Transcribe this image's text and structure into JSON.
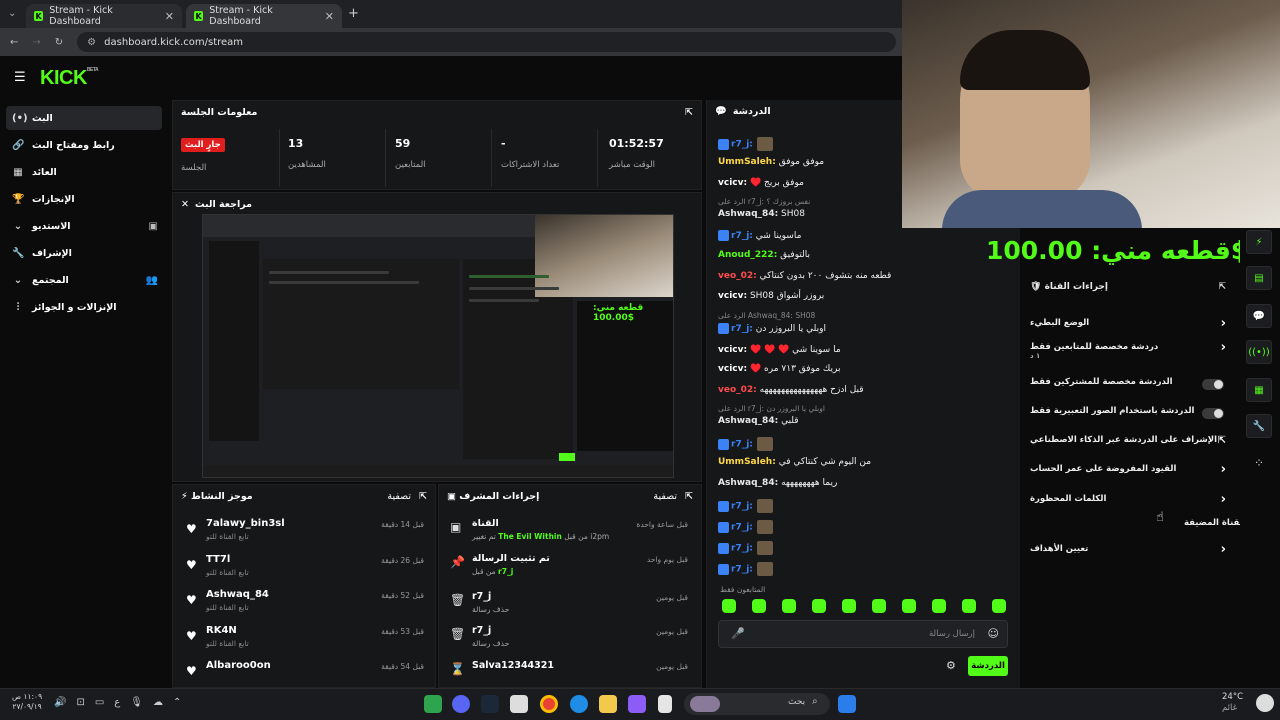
{
  "browser": {
    "tabs": [
      {
        "title": "Stream - Kick Dashboard"
      },
      {
        "title": "Stream - Kick Dashboard"
      }
    ],
    "url": "dashboard.kick.com/stream"
  },
  "kick": {
    "logo": "KICK",
    "logo_sup": "BETA"
  },
  "sidebar": {
    "items": [
      {
        "label": "البث",
        "icon": "broadcast-icon"
      },
      {
        "label": "رابط ومفتاح البث",
        "icon": "link-icon"
      },
      {
        "label": "العائد",
        "icon": "dollar-icon"
      },
      {
        "label": "الإنجازات",
        "icon": "trophy-icon"
      },
      {
        "label": "الاستديو",
        "icon": "chevron-down-icon"
      },
      {
        "label": "الإشراف",
        "icon": "wrench-icon"
      },
      {
        "label": "المجتمع",
        "icon": "chevron-down-icon"
      },
      {
        "label": "الإنزالات و الجوائز",
        "icon": "gift-icon"
      }
    ]
  },
  "session": {
    "title": "معلومات الجلسة",
    "live_badge": "جارٍ البث",
    "session_label": "الجلسة",
    "viewers": "13",
    "viewers_label": "المشاهدين",
    "followers": "59",
    "followers_label": "المتابعين",
    "subs": "-",
    "subs_label": "تعداد الاشتراكات",
    "uptime": "01:52:57",
    "uptime_label": "الوقت مباشر"
  },
  "preview": {
    "title": "مراجعة البث",
    "overlay_text": "قطعه مني: 100.00$"
  },
  "activity": {
    "title": "موجز النشاط",
    "filter": "تصفية",
    "items": [
      {
        "name": "7alawy_bin3sl",
        "sub": "تابع القناة للتو",
        "time": "قبل 14 دقيقة"
      },
      {
        "name": "TT7l",
        "sub": "تابع القناة للتو",
        "time": "قبل 26 دقيقة"
      },
      {
        "name": "Ashwaq_84",
        "sub": "تابع القناة للتو",
        "time": "قبل 52 دقيقة"
      },
      {
        "name": "RK4N",
        "sub": "تابع القناة للتو",
        "time": "قبل 53 دقيقة"
      },
      {
        "name": "Albaroo0on",
        "sub": "تابع القناة للتو",
        "time": "قبل 54 دقيقة"
      }
    ]
  },
  "modactions": {
    "title": "إجراءات المشرف",
    "filter": "تصفية",
    "items": [
      {
        "name": "القناة",
        "sub_pre": "تم تغيير ",
        "sub_hl": "The Evil Within",
        "sub_post": " من قبل i2pm",
        "time": "قبل ساعة واحدة",
        "icon": "channel-icon"
      },
      {
        "name": "تم تثبيت الرسالة",
        "sub_pre": "من قبل ",
        "sub_hl": "r7_j",
        "sub_post": "",
        "time": "قبل يوم واحد",
        "icon": "pin-icon"
      },
      {
        "name": "r7_j",
        "sub_pre": "حذف رسالة",
        "sub_hl": "",
        "sub_post": "",
        "time": "قبل يومين",
        "icon": "trash-icon"
      },
      {
        "name": "r7_j",
        "sub_pre": "حذف رسالة",
        "sub_hl": "",
        "sub_post": "",
        "time": "قبل يومين",
        "icon": "trash-icon"
      },
      {
        "name": "Salva12344321",
        "sub_pre": "",
        "sub_hl": "",
        "sub_post": "",
        "time": "قبل يومين",
        "icon": "hourglass-icon"
      }
    ]
  },
  "chat": {
    "title": "الدردشة",
    "lines": [
      {
        "user": "r7_j:",
        "text": "",
        "color": "#3b82f6",
        "badge": true,
        "avatar": true
      },
      {
        "user": "UmmSaleh:",
        "text": " موفق موفق",
        "color": "#ffd84a"
      },
      {
        "user": "vcicv:",
        "text": " ♥️ موفق بريج",
        "color": "#ffffff"
      },
      {
        "user": "",
        "text": "الرد على r7_j: نفس بروزك ؟",
        "color": "#888",
        "reply": true
      },
      {
        "user": "Ashwaq_84:",
        "text": " SH08",
        "color": "#e8e8e8"
      },
      {
        "user": "r7_j:",
        "text": " ماسوينا شي",
        "color": "#3b82f6",
        "badge": true
      },
      {
        "user": "Anoud_222:",
        "text": " بالتوفيق",
        "color": "#53fc18"
      },
      {
        "user": "veo_02:",
        "text": " قطعه منه بتشوف ٢٠٠ بدون كنتاكي",
        "color": "#ff4d4d"
      },
      {
        "user": "vcicv:",
        "text": " SH08 بروزر أشواق",
        "color": "#ffffff"
      },
      {
        "user": "",
        "text": "الرد على Ashwaq_84: SH08",
        "color": "#888",
        "reply": true
      },
      {
        "user": "r7_j:",
        "text": " اوبلي يا البروزر دن",
        "color": "#3b82f6",
        "badge": true
      },
      {
        "user": "vcicv:",
        "text": " ♥️ ♥️ ♥️ ما سوينا شي",
        "color": "#ffffff"
      },
      {
        "user": "vcicv:",
        "text": " ♥️ بريك موفق ٧١٣ مره",
        "color": "#ffffff"
      },
      {
        "user": "veo_02:",
        "text": " قبل ادزح هههههههههههههههه",
        "color": "#ff4d4d"
      },
      {
        "user": "",
        "text": "الرد على r7_j: اوبلي يا البروزر دن",
        "color": "#888",
        "reply": true
      },
      {
        "user": "Ashwaq_84:",
        "text": " قلبي",
        "color": "#e8e8e8"
      },
      {
        "user": "r7_j:",
        "text": "",
        "color": "#3b82f6",
        "badge": true,
        "avatar": true
      },
      {
        "user": "UmmSaleh:",
        "text": " من اليوم شي كنتاكي في",
        "color": "#ffd84a"
      },
      {
        "user": "Ashwaq_84:",
        "text": " ريما ههههههههه",
        "color": "#e8e8e8"
      },
      {
        "user": "r7_j:",
        "text": "",
        "color": "#3b82f6",
        "badge": true,
        "avatar": true
      },
      {
        "user": "r7_j:",
        "text": "",
        "color": "#3b82f6",
        "badge": true,
        "avatar": true
      },
      {
        "user": "r7_j:",
        "text": "",
        "color": "#3b82f6",
        "badge": true,
        "avatar": true
      },
      {
        "user": "r7_j:",
        "text": "",
        "color": "#3b82f6",
        "badge": true,
        "avatar": true
      }
    ],
    "followers_only": "المتابعون فقط",
    "input_placeholder": "إرسال رسالة",
    "send_label": "الدردشة"
  },
  "overlay": {
    "donation": "قطعه مني: 100.00$"
  },
  "channel_actions": {
    "title": "إجراءات القناة",
    "items": [
      {
        "label": "الوضع البطيء",
        "type": "chevron"
      },
      {
        "label": "دردشة مخصصة للمتابعين فقط",
        "sub": "١ د",
        "type": "chevron"
      },
      {
        "label": "الدردشة مخصصة للمشتركين فقط",
        "type": "toggle"
      },
      {
        "label": "الدردشة باستخدام الصور التعبيرية فقط",
        "type": "toggle"
      },
      {
        "label": "الإشراف على الدردشة عبر الذكاء الاصطناعي",
        "type": "external"
      },
      {
        "label": "القيود المفروضة على عمر الحساب",
        "type": "chevron"
      },
      {
        "label": "الكلمات المحظورة",
        "type": "chevron"
      },
      {
        "label": "تعيين الأهداف",
        "type": "chevron"
      }
    ],
    "featured": "القناة المضيفة"
  },
  "taskbar": {
    "time": "١١:٠٩ ص",
    "date": "٢٧/٠٩/١٩",
    "lang": "ع",
    "search": "بحث",
    "weather_temp": "24°C",
    "weather_desc": "غائم"
  },
  "colors": {
    "accent": "#53fc18",
    "live": "#e01e1e"
  }
}
